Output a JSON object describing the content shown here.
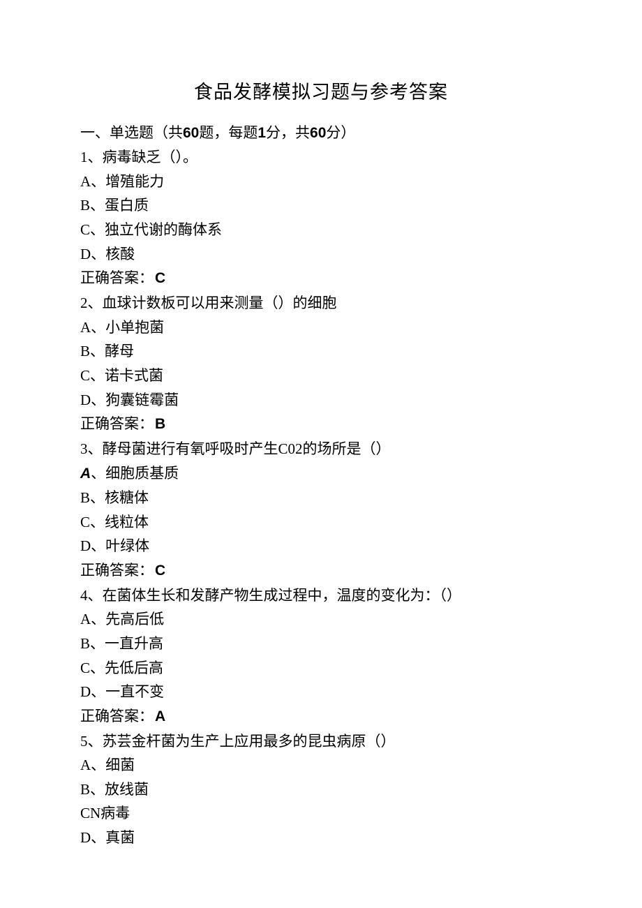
{
  "title": "食品发酵模拟习题与参考答案",
  "section": {
    "prefix": "一、单选题（共",
    "count1": "60",
    "mid1": "题，每题",
    "points": "1",
    "mid2": "分，共",
    "count2": "60",
    "suffix": "分）"
  },
  "q1": {
    "stem": "1、病毒缺乏（）。",
    "A": "A、增殖能力",
    "B": "B、蛋白质",
    "C": "C、独立代谢的酶体系",
    "D": "D、核酸",
    "ansLabel": "正确答案：",
    "ans": "C"
  },
  "q2": {
    "stem": "2、血球计数板可以用来测量（）的细胞",
    "A": "A、小单抱菌",
    "B": "B、酵母",
    "C": "C、诺卡式菌",
    "D": "D、狗囊链霉菌",
    "ansLabel": "正确答案：",
    "ans": "B"
  },
  "q3": {
    "stem": "3、酵母菌进行有氧呼吸时产生C02的场所是（）",
    "A_pre": "A",
    "A_rest": "、细胞质基质",
    "B": "B、核糖体",
    "C": "C、线粒体",
    "D": "D、叶绿体",
    "ansLabel": "正确答案：",
    "ans": "C"
  },
  "q4": {
    "stem": "4、在菌体生长和发酵产物生成过程中，温度的变化为：（）",
    "A": "A、先高后低",
    "B": "B、一直升高",
    "C": "C、先低后高",
    "D": "D、一直不变",
    "ansLabel": "正确答案：",
    "ans": "A"
  },
  "q5": {
    "stem": "5、苏芸金杆菌为生产上应用最多的昆虫病原（）",
    "A": "A、细菌",
    "B": "B、放线菌",
    "C": "CN病毒",
    "D": "D、真菌"
  }
}
